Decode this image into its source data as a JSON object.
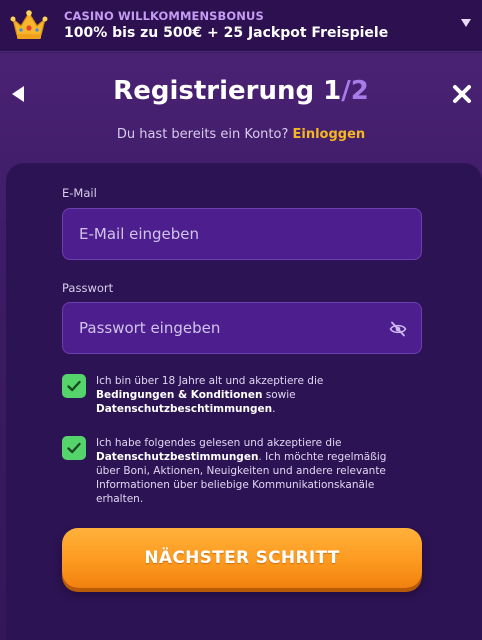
{
  "banner": {
    "title": "CASINO WILLKOMMENSBONUS",
    "offer": "100% bis zu 500€ + 25 Jackpot Freispiele",
    "icon": "crown-icon",
    "toggle_icon": "chevron-down-icon"
  },
  "header": {
    "title_main": "Registrierung 1",
    "title_total": "/2",
    "back_icon": "back-arrow-icon",
    "close_icon": "close-icon",
    "login_prompt": "Du hast bereits ein Konto? ",
    "login_link": "Einloggen"
  },
  "form": {
    "email": {
      "label": "E-Mail",
      "placeholder": "E-Mail eingeben",
      "value": ""
    },
    "password": {
      "label": "Passwort",
      "placeholder": "Passwort eingeben",
      "value": "",
      "toggle_icon": "eye-slash-icon"
    },
    "consents": [
      {
        "checked": true,
        "text_before": "Ich bin über 18 Jahre alt und akzeptiere die ",
        "bold_1": "Bedingungen & Konditionen",
        "text_middle": " sowie ",
        "bold_2": "Datenschutzbeschtimmungen",
        "text_after": "."
      },
      {
        "checked": true,
        "text_before": "Ich habe folgendes gelesen und akzeptiere die ",
        "bold_1": "Datenschutzbestimmungen",
        "text_after": ". Ich möchte regelmäßig über Boni, Aktionen, Neuigkeiten und andere relevante Informationen über beliebige Kommunikationskanäle erhalten."
      }
    ],
    "next_button": "NÄCHSTER SCHRITT"
  },
  "colors": {
    "accent_orange": "#fd9a1f",
    "link_yellow": "#f5b721",
    "check_green": "#55d46b",
    "input_purple": "#4d1f8e"
  }
}
